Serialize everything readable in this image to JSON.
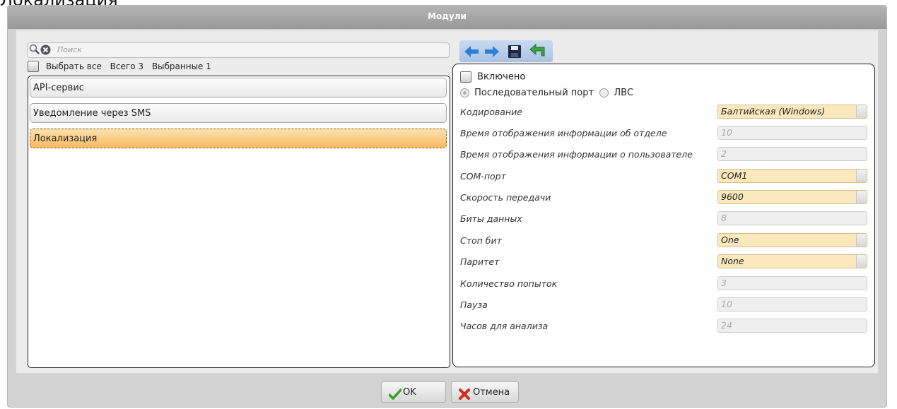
{
  "page_heading": "Локализация",
  "window": {
    "title": "Модули"
  },
  "search": {
    "placeholder": "Поиск"
  },
  "selection": {
    "select_all": "Выбрать все",
    "total": "Всего 3",
    "selected": "Выбранные 1"
  },
  "modules": [
    {
      "label": "API-сервис",
      "selected": false
    },
    {
      "label": "Уведомление через SMS",
      "selected": false
    },
    {
      "label": "Локализация",
      "selected": true
    }
  ],
  "toolbar": {
    "icons": [
      "arrow-left-icon",
      "arrow-right-icon",
      "save-icon",
      "undo-icon"
    ]
  },
  "settings": {
    "enabled_label": "Включено",
    "serial_port_label": "Последовательный порт",
    "lan_label": "ЛВС",
    "fields": [
      {
        "label": "Кодирование",
        "value": "Балтийская (Windows)",
        "kind": "select"
      },
      {
        "label": "Время отображения информации об отделе",
        "value": "10",
        "kind": "text"
      },
      {
        "label": "Время отображения информации о пользователе",
        "value": "2",
        "kind": "text"
      },
      {
        "label": "COM-порт",
        "value": "COM1",
        "kind": "select"
      },
      {
        "label": "Скорость передачи",
        "value": "9600",
        "kind": "select"
      },
      {
        "label": "Биты данных",
        "value": "8",
        "kind": "text"
      },
      {
        "label": "Стоп бит",
        "value": "One",
        "kind": "select"
      },
      {
        "label": "Паритет",
        "value": "None",
        "kind": "select"
      },
      {
        "label": "Количество попыток",
        "value": "3",
        "kind": "text"
      },
      {
        "label": "Пауза",
        "value": "10",
        "kind": "text"
      },
      {
        "label": "Часов для анализа",
        "value": "24",
        "kind": "text"
      }
    ]
  },
  "buttons": {
    "ok": "OK",
    "cancel": "Отмена"
  },
  "colors": {
    "select_bg": "#fbe9bd",
    "selected_item": "#f6b95e",
    "toolbar_blue": "#2b7fd8",
    "ok_green": "#3a9d2a",
    "cancel_red": "#d8281c"
  }
}
